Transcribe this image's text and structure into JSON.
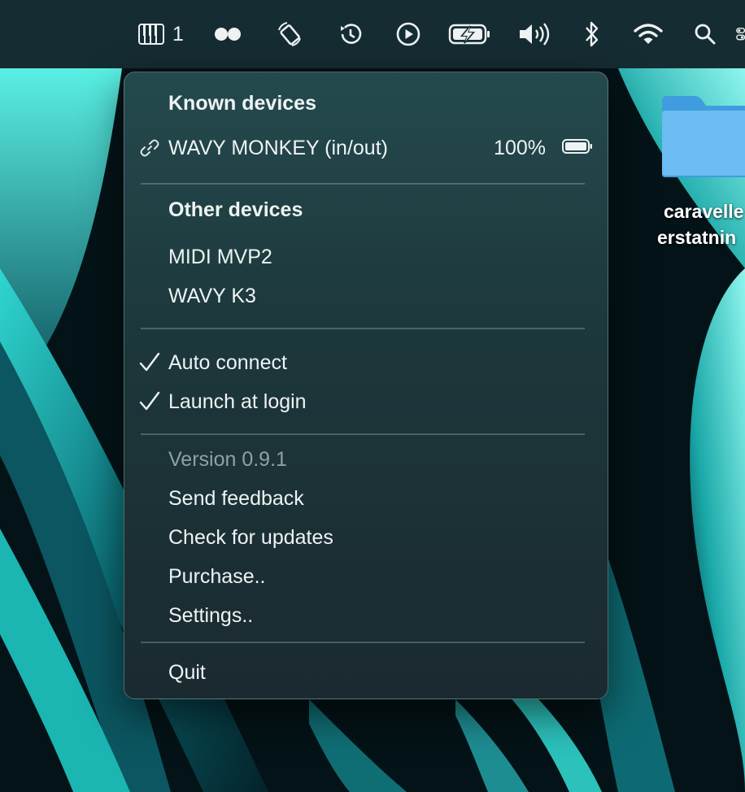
{
  "menubar": {
    "icons": [
      {
        "name": "piano-keys-icon"
      },
      {
        "name": "dual-dots-icon"
      },
      {
        "name": "rotation-icon"
      },
      {
        "name": "time-machine-icon"
      },
      {
        "name": "play-circle-icon"
      },
      {
        "name": "battery-charging-icon"
      },
      {
        "name": "volume-icon"
      },
      {
        "name": "bluetooth-icon"
      },
      {
        "name": "wifi-icon"
      },
      {
        "name": "search-icon"
      },
      {
        "name": "control-center-icon"
      }
    ],
    "piano_count": "1"
  },
  "desktop": {
    "folder_label_line1": "caravelle",
    "folder_label_line2": "erstatnin"
  },
  "menu": {
    "known_header": "Known devices",
    "known_devices": [
      {
        "name": "WAVY MONKEY (in/out)",
        "battery": "100%",
        "icon": "link-icon"
      }
    ],
    "other_header": "Other devices",
    "other_devices": [
      "MIDI MVP2",
      "WAVY K3"
    ],
    "options": [
      {
        "label": "Auto connect",
        "checked": true
      },
      {
        "label": "Launch at login",
        "checked": true
      }
    ],
    "version": "Version 0.9.1",
    "actions": [
      "Send feedback",
      "Check for updates",
      "Purchase..",
      "Settings.."
    ],
    "quit": "Quit"
  }
}
